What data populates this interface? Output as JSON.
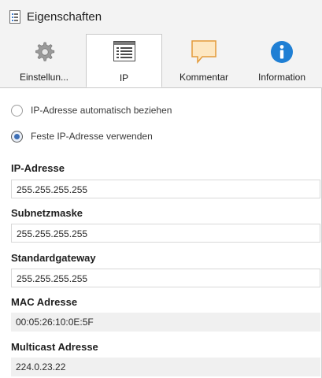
{
  "window": {
    "title": "Eigenschaften",
    "icon": "properties-document-icon"
  },
  "tabs": [
    {
      "label": "Einstellun...",
      "icon": "gear-icon",
      "active": false
    },
    {
      "label": "IP",
      "icon": "ip-list-window-icon",
      "active": true
    },
    {
      "label": "Kommentar",
      "icon": "comment-bubble-icon",
      "active": false
    },
    {
      "label": "Information",
      "icon": "info-icon",
      "active": false
    }
  ],
  "ip_mode": {
    "options": [
      {
        "label": "IP-Adresse automatisch beziehen",
        "checked": false
      },
      {
        "label": "Feste IP-Adresse verwenden",
        "checked": true
      }
    ]
  },
  "fields": {
    "ip_address": {
      "label": "IP-Adresse",
      "value": "255.255.255.255"
    },
    "subnet_mask": {
      "label": "Subnetzmaske",
      "value": "255.255.255.255"
    },
    "gateway": {
      "label": "Standardgateway",
      "value": "255.255.255.255"
    },
    "mac": {
      "label": "MAC Adresse",
      "value": "00:05:26:10:0E:5F"
    },
    "multicast": {
      "label": "Multicast Adresse",
      "value": "224.0.23.22"
    }
  },
  "colors": {
    "accent_blue": "#1f7fd4",
    "comment_orange": "#e9a548",
    "background_gray": "#f3f3f3"
  }
}
